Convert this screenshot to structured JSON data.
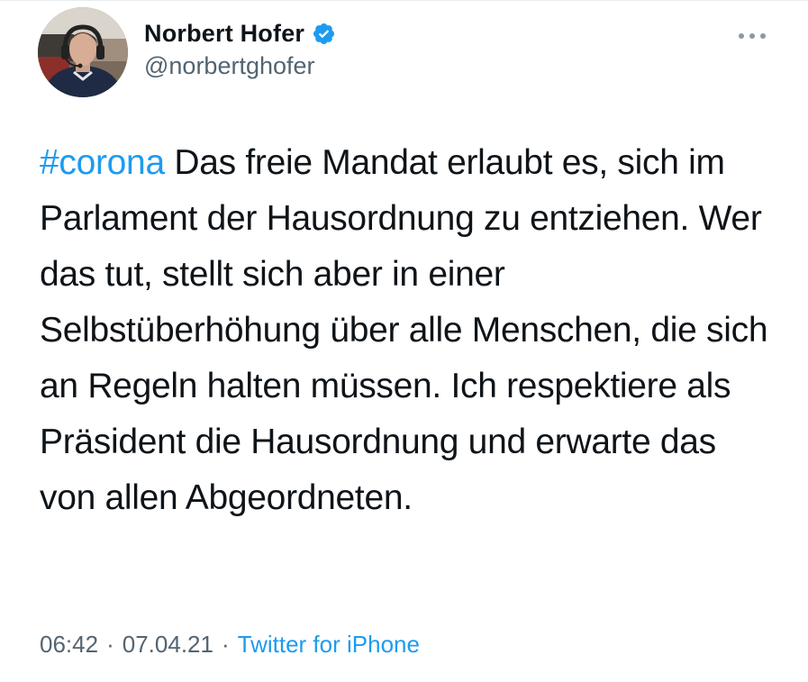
{
  "tweet": {
    "author": {
      "display_name": "Norbert Hofer",
      "handle": "@norbertghofer",
      "verified": true
    },
    "hashtag": "#corona",
    "text": " Das freie Mandat erlaubt es, sich im Parlament der Hausordnung zu entziehen. Wer das tut, stellt sich aber in einer Selbstüberhöhung über alle Menschen, die sich an Regeln halten müssen. Ich respektiere als Präsident die Hausordnung und erwarte das von allen Abgeordneten.",
    "time": "06:42",
    "separator": "·",
    "date": "07.04.21",
    "source": "Twitter for iPhone"
  },
  "icons": {
    "verified": "verified-badge-icon",
    "more": "more-options-icon"
  },
  "colors": {
    "link": "#1d9bf0",
    "secondary_text": "#536471",
    "primary_text": "#0f1419"
  }
}
